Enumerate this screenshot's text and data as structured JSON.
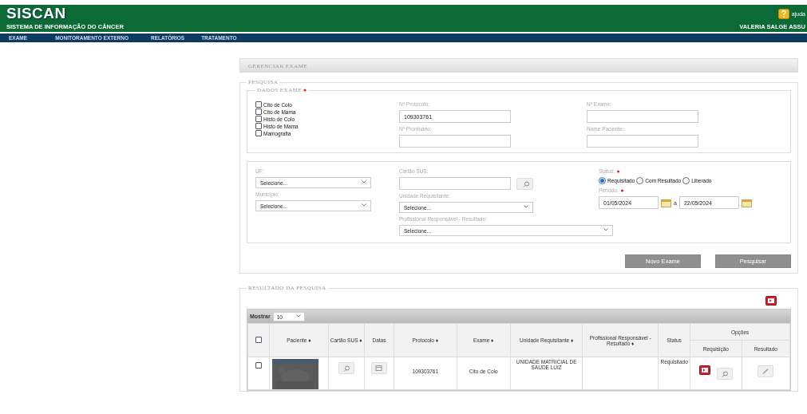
{
  "header": {
    "title": "SISCAN",
    "subtitle": "SISTEMA DE INFORMAÇÃO DO CÂNCER",
    "help_label": "ajuda",
    "user": "VALERIA SALGE ASSU"
  },
  "nav": [
    "EXAME",
    "MONITORAMENTO EXTERNO",
    "RELATÓRIOS",
    "TRATAMENTO"
  ],
  "page_title": "GERENCIAR EXAME",
  "search": {
    "legend": "PESQUISA",
    "exam_legend": "DADOS EXAME",
    "exam_types": [
      {
        "label": "Cito de Colo",
        "checked": false
      },
      {
        "label": "Cito de Mama",
        "checked": false
      },
      {
        "label": "Histo de Colo",
        "checked": false
      },
      {
        "label": "Histo de Mama",
        "checked": false
      },
      {
        "label": "Mamografia",
        "checked": false
      }
    ],
    "protocol": {
      "label": "Nº Protocolo:",
      "value": "109303761"
    },
    "exam_number": {
      "label": "Nº Exame:"
    },
    "record_number": {
      "label": "Nº Prontuário:"
    },
    "patient_name": {
      "label": "Nome Paciente:"
    },
    "uf": {
      "label": "UF:",
      "value": "Selecione..."
    },
    "city": {
      "label": "Município:",
      "value": "Selecione..."
    },
    "sus_card": {
      "label": "Cartão SUS:"
    },
    "unit": {
      "label": "Unidade Requisitante:",
      "value": "Selecione..."
    },
    "professional": {
      "label": "Profissional Responsável - Resultado:",
      "value": "Selecione..."
    },
    "status": {
      "label": "Status:",
      "options": [
        {
          "label": "Requisitado",
          "selected": true
        },
        {
          "label": "Com Resultado",
          "selected": false
        },
        {
          "label": "Liberado",
          "selected": false
        }
      ]
    },
    "period": {
      "label": "Período:",
      "from": "01/05/2024",
      "separator": "a",
      "to": "22/05/2024"
    },
    "buttons": [
      "Novo Exame",
      "Pesquisar"
    ]
  },
  "results": {
    "legend": "RESULTADO DA PESQUISA",
    "show_label": "Mostrar",
    "page_size": "10",
    "columns": [
      "Paciente ♦",
      "Cartão SUS ♦",
      "Datas",
      "Protocolo ♦",
      "Exame ♦",
      "Unidade Requisitante ♦",
      "Profissional Responsável - Resultado ♦",
      "Status",
      "Opções"
    ],
    "option_columns": [
      "Requisição",
      "Resultado"
    ],
    "select_all_checked": false,
    "rows": [
      {
        "checked": false,
        "protocol": "109303761",
        "exam": "Cito de Colo",
        "unit": "UNIDADE MATRICIAL DE SAUDE LUIZ",
        "professional": "",
        "status": "Requisitado"
      }
    ]
  }
}
